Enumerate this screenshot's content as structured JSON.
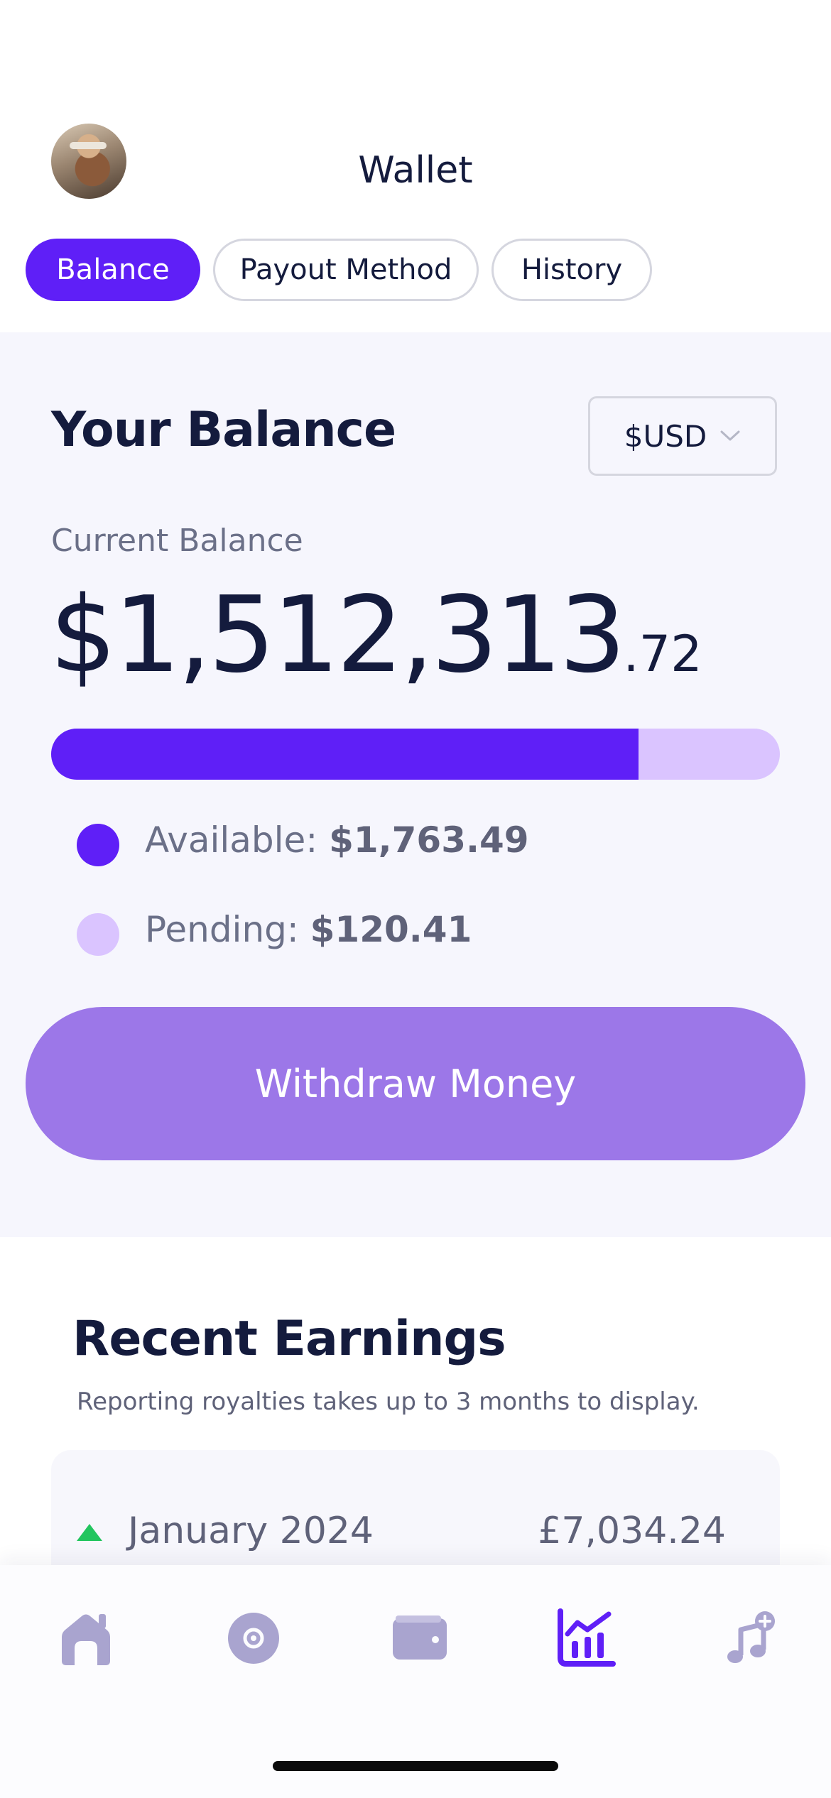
{
  "header": {
    "title": "Wallet",
    "avatar_icon": "user-avatar"
  },
  "tabs": [
    {
      "label": "Balance",
      "active": true
    },
    {
      "label": "Payout Method",
      "active": false
    },
    {
      "label": "History",
      "active": false
    }
  ],
  "balance": {
    "heading": "Your Balance",
    "currency": "$USD",
    "current_label": "Current Balance",
    "amount_main": "$1,512,313",
    "amount_cents": ".72",
    "available_fraction": 0.806,
    "legend": {
      "available_label": "Available: ",
      "available_value": "$1,763.49",
      "pending_label": "Pending: ",
      "pending_value": "$120.41"
    },
    "withdraw_label": "Withdraw Money"
  },
  "earnings": {
    "heading": "Recent Earnings",
    "note": "Reporting royalties takes up to 3 months to display.",
    "rows": [
      {
        "month": "January 2024",
        "value": "£7,034.24",
        "trend": "up"
      }
    ]
  },
  "nav": {
    "items": [
      {
        "icon": "home-icon",
        "active": false
      },
      {
        "icon": "disc-icon",
        "active": false
      },
      {
        "icon": "wallet-icon",
        "active": false
      },
      {
        "icon": "analytics-icon",
        "active": true
      },
      {
        "icon": "add-music-icon",
        "active": false
      }
    ]
  },
  "colors": {
    "primary": "#5f1ff7",
    "pending": "#dac4ff",
    "withdraw_button": "#9c77e8",
    "nav_inactive": "#a9a4cf",
    "trend_up": "#22c55e"
  }
}
